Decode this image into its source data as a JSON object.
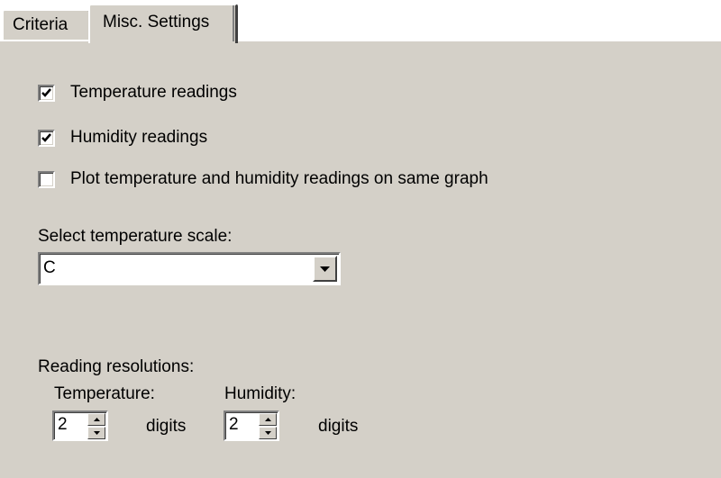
{
  "tabs": {
    "criteria_label": "Criteria",
    "misc_label": "Misc. Settings"
  },
  "options": {
    "temperature_readings": {
      "label": "Temperature readings",
      "checked": true
    },
    "humidity_readings": {
      "label": "Humidity readings",
      "checked": true
    },
    "same_graph": {
      "label": "Plot temperature and humidity readings on same graph",
      "checked": false
    }
  },
  "scale": {
    "label": "Select temperature scale:",
    "value": "C"
  },
  "resolutions": {
    "label": "Reading resolutions:",
    "temperature": {
      "label": "Temperature:",
      "value": "2",
      "unit": "digits"
    },
    "humidity": {
      "label": "Humidity:",
      "value": "2",
      "unit": "digits"
    }
  },
  "icons": {
    "checkmark": "check-icon",
    "dropdown": "down-arrow-icon",
    "spin_up": "spin-up-arrow-icon",
    "spin_down": "spin-down-arrow-icon"
  },
  "colors": {
    "panel_background": "#d4d0c8",
    "highlight": "#ffffff",
    "shadow": "#808080",
    "dark_shadow": "#404040"
  }
}
